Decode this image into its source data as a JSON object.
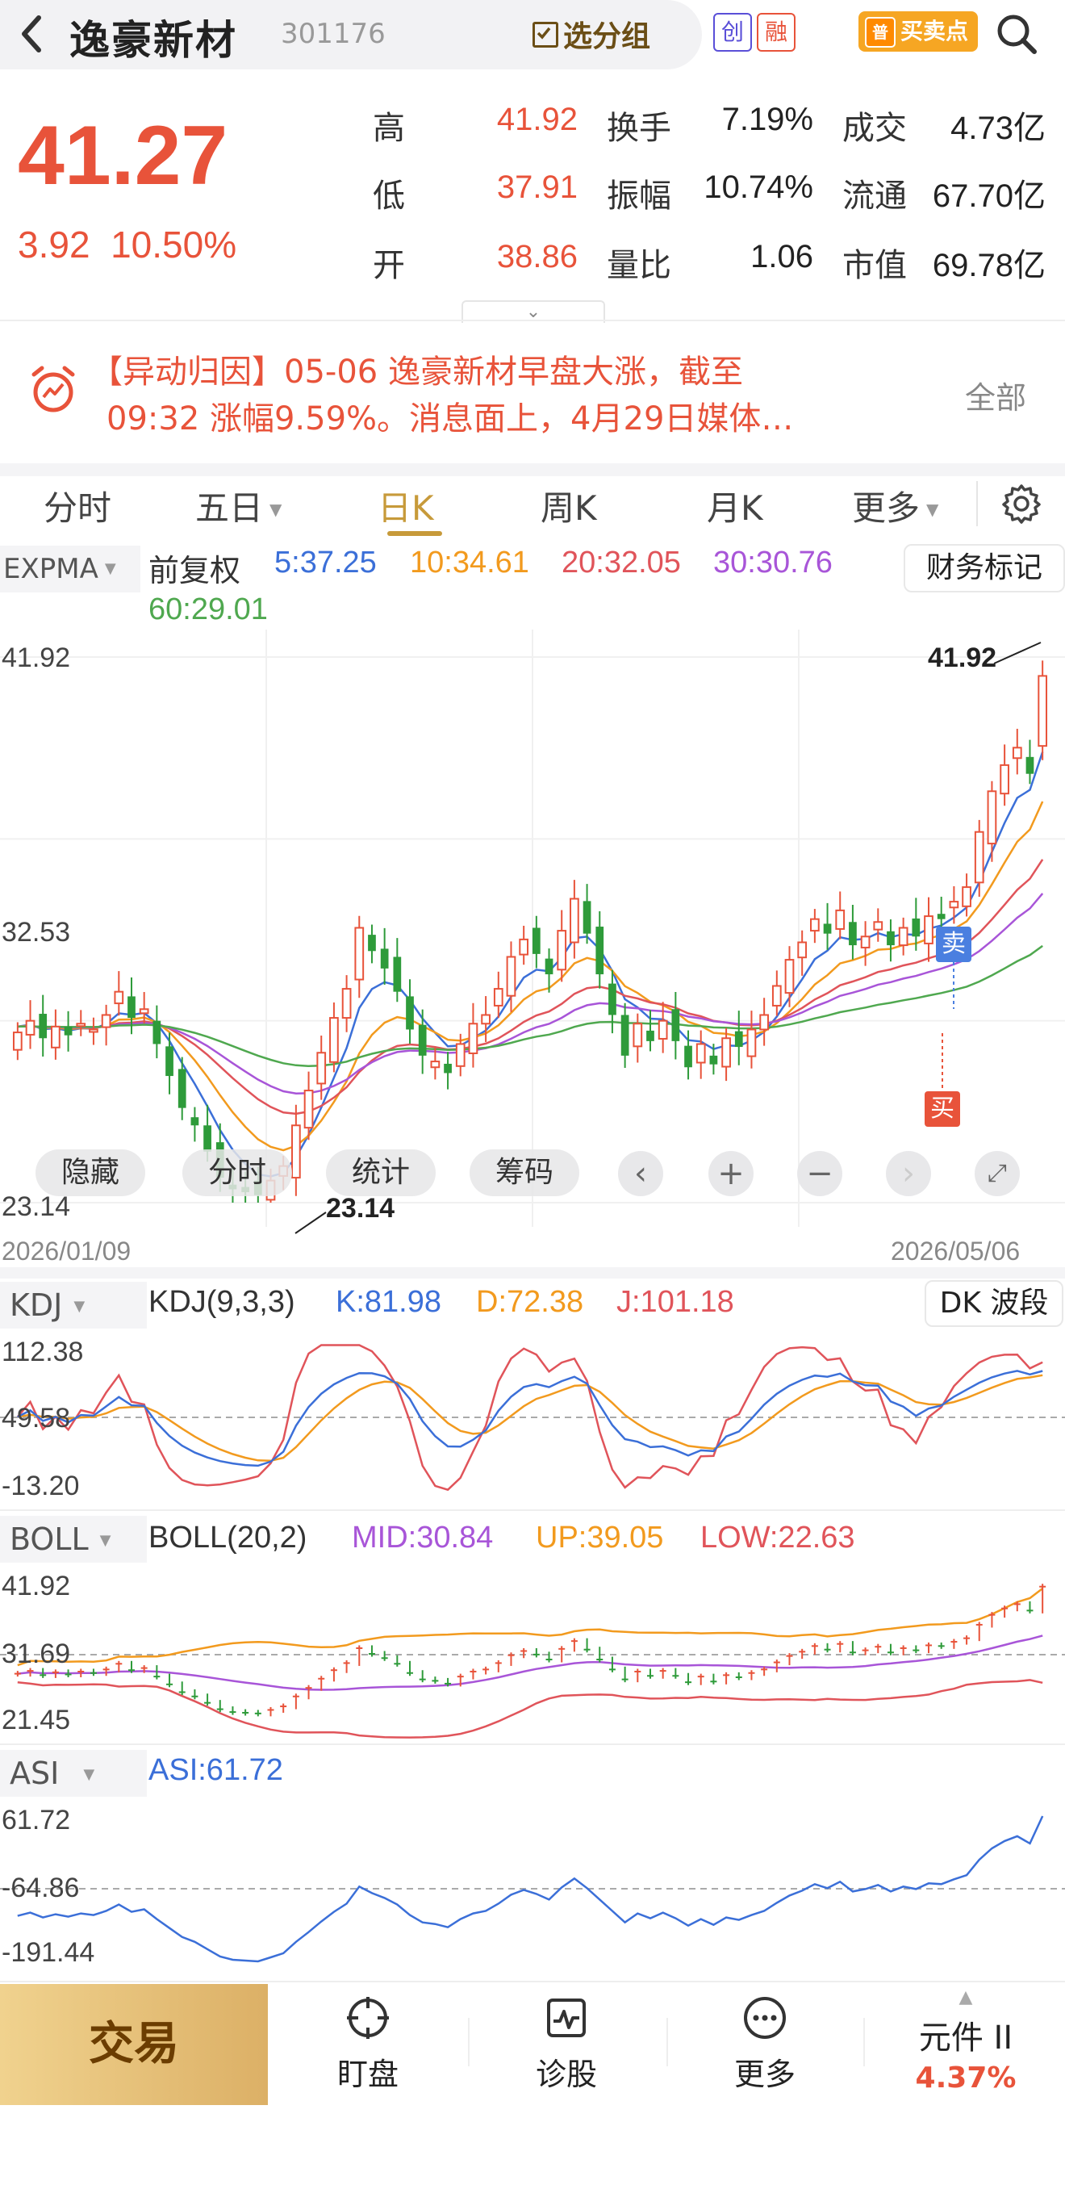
{
  "header": {
    "back_icon": "chevron-left-icon",
    "title": "逸豪新材",
    "code": "301176",
    "group_button": "选分组",
    "tag_chuang": "创",
    "tag_rong": "融",
    "trade_point_label": "买卖点",
    "trade_point_badge": "普",
    "search_icon": "search-icon"
  },
  "quote": {
    "price": "41.27",
    "change": "3.92",
    "change_pct": "10.50%",
    "rows": [
      {
        "l1": "高",
        "v1": "41.92",
        "l2": "换手",
        "v2": "7.19%",
        "l3": "成交",
        "v3": "4.73亿"
      },
      {
        "l1": "低",
        "v1": "37.91",
        "l2": "振幅",
        "v2": "10.74%",
        "l3": "流通",
        "v3": "67.70亿"
      },
      {
        "l1": "开",
        "v1": "38.86",
        "l2": "量比",
        "v2": "1.06",
        "l3": "市值",
        "v3": "69.78亿"
      }
    ],
    "colors": {
      "up": "#e8533a",
      "down": "#2e9b3a"
    }
  },
  "news": {
    "line1": "【异动归因】05-06 逸豪新材早盘大涨，截至",
    "line2": "09:32 涨幅9.59%。消息面上，4月29日媒体…",
    "all_label": "全部"
  },
  "tabs": [
    "分时",
    "五日",
    "日K",
    "周K",
    "月K",
    "更多"
  ],
  "expma": {
    "tag": "EXPMA",
    "adjust": "前复权",
    "l5": "5:37.25",
    "l10": "10:34.61",
    "l20": "20:32.05",
    "l30": "30:30.76",
    "l60": "60:29.01",
    "fin_button": "财务标记",
    "y_high": "41.92",
    "y_mid": "32.53",
    "y_low": "23.14",
    "peak_label": "41.92",
    "trough_label": "23.14",
    "sell_label": "卖",
    "buy_label": "买",
    "date_start": "2026/01/09",
    "date_end": "2026/05/06",
    "colors": {
      "ma5": "#3b6fd8",
      "ma10": "#f29a1e",
      "ma20": "#e0545a",
      "ma30": "#a855d8",
      "ma60": "#4fa84f"
    },
    "controls": [
      "隐藏",
      "分时",
      "统计",
      "筹码"
    ]
  },
  "kdj": {
    "tag": "KDJ",
    "name": "KDJ(9,3,3)",
    "k": "K:81.98",
    "d": "D:72.38",
    "j": "J:101.18",
    "button": "DK 波段",
    "y_high": "112.38",
    "y_mid": "49.58",
    "y_low": "-13.20"
  },
  "boll": {
    "tag": "BOLL",
    "name": "BOLL(20,2)",
    "mid": "MID:30.84",
    "up": "UP:39.05",
    "low": "LOW:22.63",
    "y_high": "41.92",
    "y_mid": "31.69",
    "y_low": "21.45"
  },
  "asi": {
    "tag": "ASI",
    "value": "ASI:61.72",
    "y_high": "61.72",
    "y_mid": "-64.86",
    "y_low": "-191.44"
  },
  "bottom": {
    "trade": "交易",
    "watch": "盯盘",
    "diagnose": "诊股",
    "more": "更多",
    "component_name": "元件 II",
    "component_pct": "4.37%"
  },
  "chart_data": {
    "type": "candlestick",
    "title": "",
    "x_range": [
      "2026/01/09",
      "2026/05/06"
    ],
    "ylim": [
      23.14,
      41.92
    ],
    "close": [
      29.0,
      29.4,
      28.8,
      29.2,
      28.9,
      29.3,
      29.1,
      29.6,
      30.4,
      29.5,
      29.8,
      28.6,
      27.5,
      26.4,
      25.8,
      24.9,
      24.0,
      23.6,
      23.5,
      23.4,
      23.9,
      24.4,
      25.8,
      27.0,
      28.3,
      29.5,
      30.5,
      32.6,
      31.8,
      31.2,
      30.4,
      29.1,
      28.2,
      28.0,
      27.6,
      28.6,
      29.3,
      29.6,
      30.5,
      31.6,
      32.2,
      31.7,
      31.0,
      32.5,
      33.6,
      32.4,
      31.0,
      29.6,
      28.2,
      29.3,
      28.7,
      29.4,
      28.7,
      27.8,
      28.6,
      27.9,
      28.8,
      28.5,
      29.1,
      29.6,
      30.6,
      31.5,
      32.1,
      32.9,
      32.4,
      33.2,
      32.0,
      32.3,
      32.8,
      32.0,
      32.6,
      32.3,
      33.0,
      32.9,
      33.5,
      34.0,
      35.9,
      37.3,
      38.2,
      38.8,
      37.9,
      41.27
    ]
  }
}
